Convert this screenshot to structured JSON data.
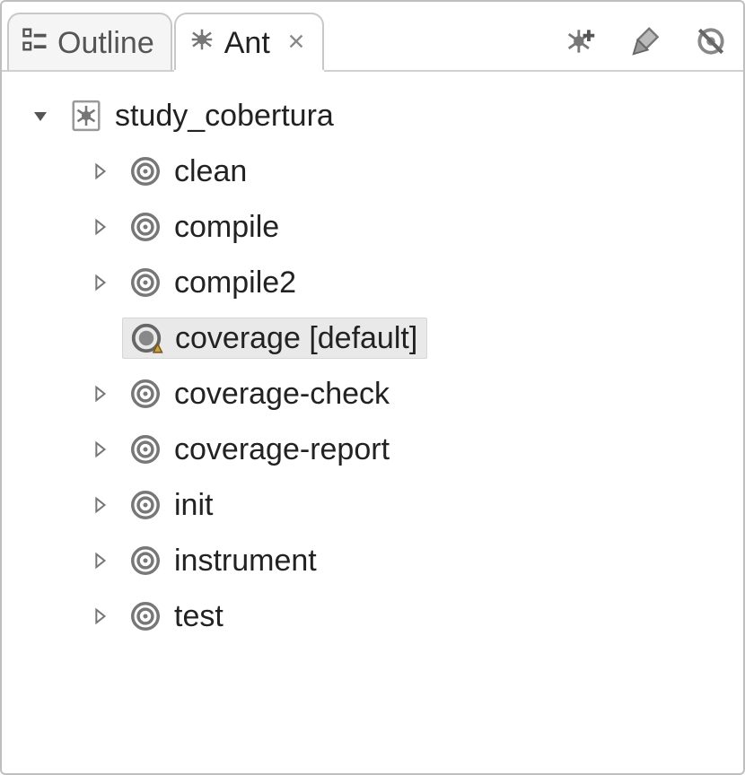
{
  "tabs": {
    "outline": {
      "label": "Outline"
    },
    "ant": {
      "label": "Ant"
    }
  },
  "tree": {
    "root": {
      "label": "study_cobertura"
    },
    "targets": [
      {
        "label": "clean",
        "expandable": true,
        "selected": false,
        "default": false
      },
      {
        "label": "compile",
        "expandable": true,
        "selected": false,
        "default": false
      },
      {
        "label": "compile2",
        "expandable": true,
        "selected": false,
        "default": false
      },
      {
        "label": "coverage [default]",
        "expandable": false,
        "selected": true,
        "default": true
      },
      {
        "label": "coverage-check",
        "expandable": true,
        "selected": false,
        "default": false
      },
      {
        "label": "coverage-report",
        "expandable": true,
        "selected": false,
        "default": false
      },
      {
        "label": "init",
        "expandable": true,
        "selected": false,
        "default": false
      },
      {
        "label": "instrument",
        "expandable": true,
        "selected": false,
        "default": false
      },
      {
        "label": "test",
        "expandable": true,
        "selected": false,
        "default": false
      }
    ]
  }
}
